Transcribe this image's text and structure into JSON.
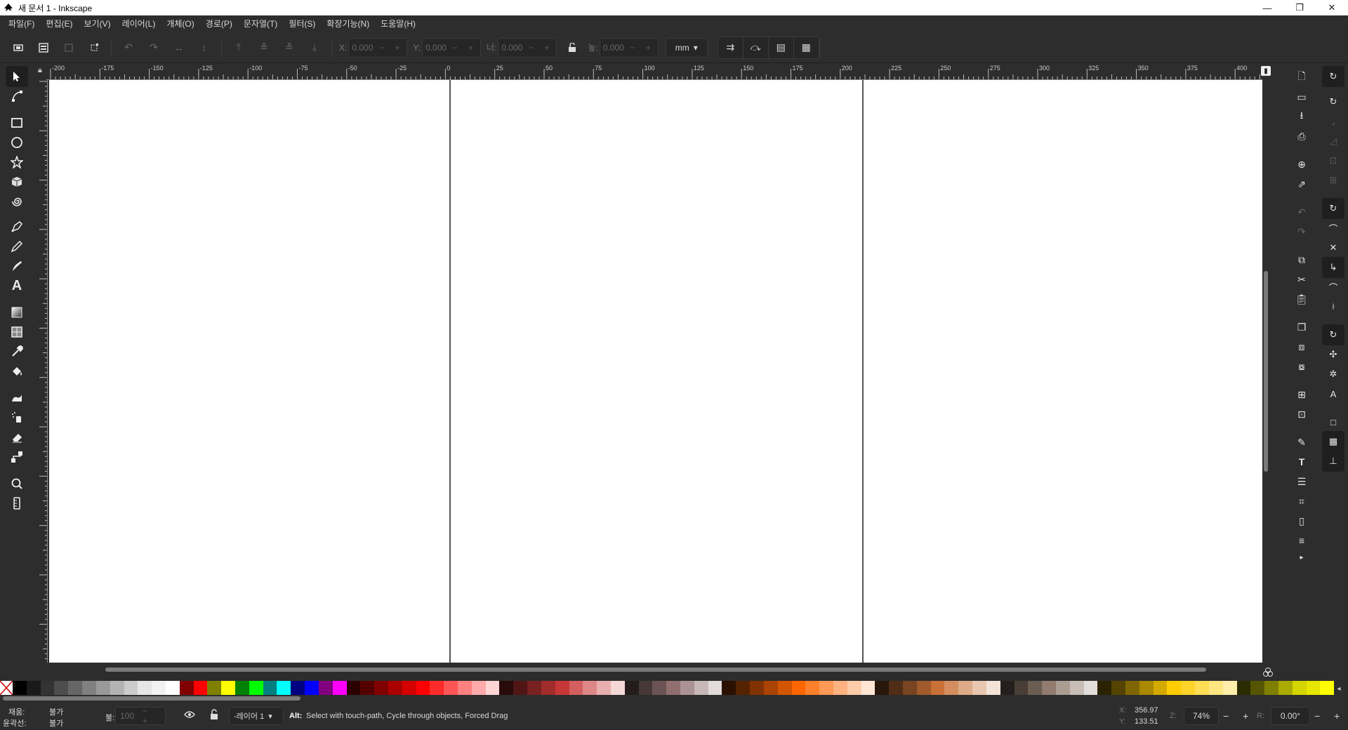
{
  "window": {
    "title": "새 문서 1 - Inkscape",
    "minimize": "—",
    "maximize": "❐",
    "close": "✕"
  },
  "menu": [
    "파일(F)",
    "편집(E)",
    "보기(V)",
    "레이어(L)",
    "개체(O)",
    "경로(P)",
    "문자열(T)",
    "필터(S)",
    "확장기능(N)",
    "도움말(H)"
  ],
  "toolbar": {
    "x_label": "X:",
    "x_value": "0.000",
    "y_label": "Y:",
    "y_value": "0.000",
    "w_label": "너:",
    "w_value": "0.000",
    "h_label": "높:",
    "h_value": "0.000",
    "unit": "mm",
    "spin": "− +"
  },
  "ruler": {
    "top_labels": [
      "-200",
      "-175",
      "-150",
      "-125",
      "-100",
      "-75",
      "-50",
      "-25",
      "0",
      "25",
      "50",
      "75",
      "100",
      "125",
      "150",
      "175",
      "200",
      "225",
      "250",
      "275",
      "300",
      "325",
      "350",
      "375",
      "400"
    ]
  },
  "tools": [
    {
      "name": "selector-tool",
      "icon": "arrow"
    },
    {
      "name": "node-tool",
      "icon": "node"
    },
    {
      "name": "rectangle-tool",
      "icon": "rect"
    },
    {
      "name": "ellipse-tool",
      "icon": "circle"
    },
    {
      "name": "star-tool",
      "icon": "star"
    },
    {
      "name": "3d-box-tool",
      "icon": "box"
    },
    {
      "name": "spiral-tool",
      "icon": "spiral"
    },
    {
      "name": "pen-tool",
      "icon": "pen"
    },
    {
      "name": "pencil-tool",
      "icon": "pencil"
    },
    {
      "name": "calligraphy-tool",
      "icon": "callig"
    },
    {
      "name": "text-tool",
      "icon": "text"
    },
    {
      "name": "gradient-tool",
      "icon": "gradient"
    },
    {
      "name": "mesh-tool",
      "icon": "mesh"
    },
    {
      "name": "dropper-tool",
      "icon": "dropper"
    },
    {
      "name": "paint-bucket-tool",
      "icon": "bucket"
    },
    {
      "name": "tweak-tool",
      "icon": "tweak"
    },
    {
      "name": "spray-tool",
      "icon": "spray"
    },
    {
      "name": "eraser-tool",
      "icon": "eraser"
    },
    {
      "name": "connector-tool",
      "icon": "connector"
    },
    {
      "name": "zoom-tool",
      "icon": "zoom"
    },
    {
      "name": "measure-tool",
      "icon": "measure"
    }
  ],
  "tool_glyphs": {
    "text_tool": "A"
  },
  "palette_colors": [
    "#000000",
    "#1a1a1a",
    "#333333",
    "#4d4d4d",
    "#666666",
    "#808080",
    "#999999",
    "#b3b3b3",
    "#cccccc",
    "#e6e6e6",
    "#f2f2f2",
    "#ffffff",
    "#800000",
    "#ff0000",
    "#808000",
    "#ffff00",
    "#008000",
    "#00ff00",
    "#008080",
    "#00ffff",
    "#000080",
    "#0000ff",
    "#800080",
    "#ff00ff",
    "#2b0000",
    "#550000",
    "#800000",
    "#aa0000",
    "#d40000",
    "#ff0000",
    "#ff2a2a",
    "#ff5555",
    "#ff8080",
    "#ffaaaa",
    "#ffd5d5",
    "#280b0b",
    "#501616",
    "#782121",
    "#a02c2c",
    "#c83737",
    "#d35f5f",
    "#de8787",
    "#e9afaf",
    "#f4d7d7",
    "#241c1c",
    "#483737",
    "#6c5353",
    "#916f6f",
    "#ac9393",
    "#c8b7b7",
    "#e3dbdb",
    "#2b1100",
    "#552200",
    "#803300",
    "#aa4400",
    "#d45500",
    "#ff6600",
    "#ff7f2a",
    "#ff9955",
    "#ffb380",
    "#ffccaa",
    "#ffe6d5",
    "#28170b",
    "#502d16",
    "#784421",
    "#a05a2c",
    "#c87137",
    "#d38d5f",
    "#deaa87",
    "#e9c6af",
    "#f4e3d7",
    "#241f1c",
    "#483e37",
    "#6c5d53",
    "#917c6f",
    "#ac9d93",
    "#c8beb7",
    "#e3dedb",
    "#2b2200",
    "#554400",
    "#806600",
    "#aa8800",
    "#d4aa00",
    "#ffcc00",
    "#ffd42a",
    "#ffdd55",
    "#ffe680",
    "#ffeeaa",
    "#2b2b00",
    "#555500",
    "#808000",
    "#aaaa00",
    "#d4d400",
    "#e5e500",
    "#ffff00"
  ],
  "status": {
    "fill_label": "채움:",
    "fill_value": "불가",
    "stroke_label": "윤곽선:",
    "stroke_value": "불가",
    "opacity_label": "불:",
    "opacity_value": "100",
    "layer": "-레이어 1",
    "message_bold": "Alt:",
    "message": "Select with touch-path, Cycle through objects, Forced Drag",
    "cursor_x_label": "X:",
    "cursor_x": "356.97",
    "cursor_y_label": "Y:",
    "cursor_y": "133.51",
    "zoom_label": "Z:",
    "zoom": "74%",
    "rotate_label": "R:",
    "rotate": "0.00°"
  }
}
